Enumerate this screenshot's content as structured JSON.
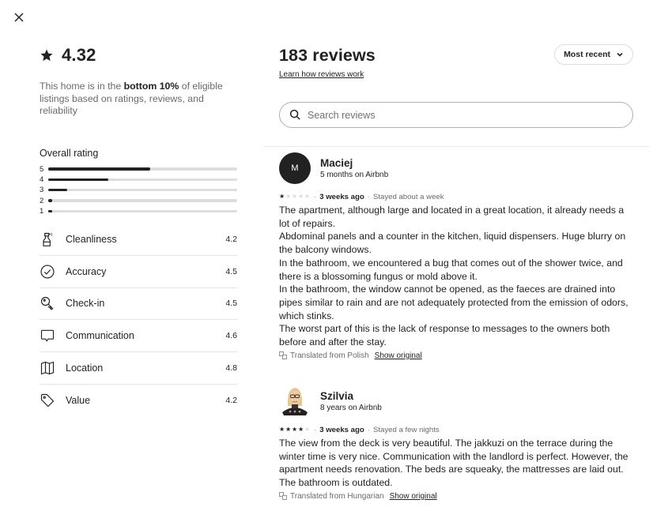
{
  "close_icon": "close-icon",
  "summary": {
    "rating": "4.32",
    "rank_prefix": "This home is in the ",
    "rank_bold": "bottom 10%",
    "rank_suffix": " of eligible listings based on ratings, reviews, and reliability"
  },
  "overall": {
    "title": "Overall rating",
    "bars": [
      {
        "label": "5",
        "fraction": 0.54
      },
      {
        "label": "4",
        "fraction": 0.32
      },
      {
        "label": "3",
        "fraction": 0.1
      },
      {
        "label": "2",
        "fraction": 0.02
      },
      {
        "label": "1",
        "fraction": 0.02
      }
    ]
  },
  "categories": [
    {
      "name": "Cleanliness",
      "score": "4.2",
      "icon": "spray-bottle-icon"
    },
    {
      "name": "Accuracy",
      "score": "4.5",
      "icon": "check-circle-icon"
    },
    {
      "name": "Check-in",
      "score": "4.5",
      "icon": "key-icon"
    },
    {
      "name": "Communication",
      "score": "4.6",
      "icon": "chat-bubble-icon"
    },
    {
      "name": "Location",
      "score": "4.8",
      "icon": "map-icon"
    },
    {
      "name": "Value",
      "score": "4.2",
      "icon": "tag-icon"
    }
  ],
  "reviews_header": {
    "title": "183 reviews",
    "learn_link": "Learn how reviews work",
    "sort_label": "Most recent",
    "search_placeholder": "Search reviews"
  },
  "reviews": [
    {
      "name": "Maciej",
      "avatar_initial": "M",
      "tenure": "5 months on Airbnb",
      "stars": 1,
      "when": "3 weeks ago",
      "stay": "Stayed about a week",
      "lines": [
        "The apartment, although large and located in a great location, it already needs a lot of repairs.",
        "Abdominal panels and a counter in the kitchen, liquid dispensers. Huge blurry on the balcony windows.",
        "In the bathroom, we encountered a bug that comes out of the shower twice, and there is a blossoming fungus or mold above it.",
        "In the bathroom, the window cannot be opened, as the faeces are drained into pipes similar to rain and are not adequately protected from the emission of odors, which stinks.",
        "The worst part of this is the lack of response to messages to the owners both before and after the stay."
      ],
      "translated": "Translated from Polish",
      "show_original": "Show original"
    },
    {
      "name": "Szilvia",
      "avatar_initial": "",
      "tenure": "8 years on Airbnb",
      "stars": 4,
      "when": "3 weeks ago",
      "stay": "Stayed a few nights",
      "lines": [
        "The view from the deck is very beautiful. The jakkuzi on the terrace during the winter time is very nice. Communication with the landlord is perfect. However, the apartment needs renovation. The beds are squeaky, the mattresses are laid out. The bathroom is outdated."
      ],
      "translated": "Translated from Hungarian",
      "show_original": "Show original"
    }
  ]
}
